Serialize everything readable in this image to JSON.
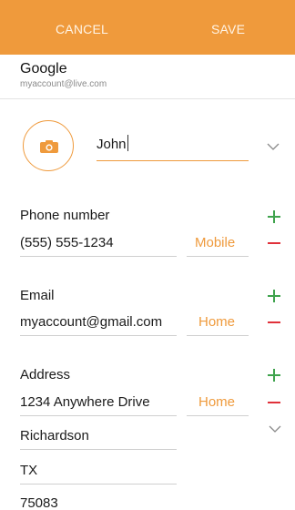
{
  "toolbar": {
    "cancel_label": "CANCEL",
    "save_label": "SAVE"
  },
  "account": {
    "name": "Google",
    "email": "myaccount@live.com"
  },
  "contact": {
    "name_value": "John",
    "phone": {
      "label": "Phone number",
      "value": "(555) 555-1234",
      "type": "Mobile"
    },
    "email": {
      "label": "Email",
      "value": "myaccount@gmail.com",
      "type": "Home"
    },
    "address": {
      "label": "Address",
      "street": "1234 Anywhere Drive",
      "city": "Richardson",
      "state": "TX",
      "zip": "75083",
      "type": "Home"
    }
  },
  "colors": {
    "accent": "#ef9a3c",
    "add": "#3fa34d",
    "remove": "#e0313a"
  },
  "icons": {
    "avatar": "camera-icon",
    "expand": "chevron-down-icon",
    "add": "plus-icon",
    "remove": "minus-icon"
  }
}
